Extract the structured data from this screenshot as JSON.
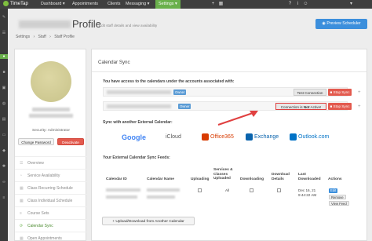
{
  "app": {
    "logo_text": "TimeTap"
  },
  "nav": {
    "items": [
      {
        "label": "Dashboard ▾"
      },
      {
        "label": "Appointments"
      },
      {
        "label": "Clients"
      },
      {
        "label": "Messaging ▾"
      },
      {
        "label": "Settings ▾"
      }
    ]
  },
  "header": {
    "title": "Profile",
    "subtitle": "Edit staff details and view availability",
    "preview_button": "Preview Scheduler"
  },
  "breadcrumb": [
    "Settings",
    "›",
    "Staff",
    "›",
    "Staff Profile"
  ],
  "profile": {
    "security": "Security: Administrator",
    "change_password": "Change Password",
    "deactivate": "Deactivate",
    "menu": [
      {
        "label": "Overview"
      },
      {
        "label": "Service Availability"
      },
      {
        "label": "Class Recurring Schedule"
      },
      {
        "label": "Class Individual Schedule"
      },
      {
        "label": "Course Sets"
      },
      {
        "label": "Calendar Sync"
      },
      {
        "label": "Open Appointments"
      }
    ]
  },
  "calendar_sync": {
    "heading": "Calendar Sync",
    "access_label": "You have access to the calendars under the accounts associated with:",
    "accounts": [
      {
        "owner_badge": "Owner",
        "test_button": "Test Connection",
        "stop_button": "Stop Sync"
      },
      {
        "owner_badge": "Owner",
        "status_prefix": "Connection is ",
        "status_bold": "Not",
        "status_suffix": " Active!",
        "stop_button": "Stop Sync"
      }
    ],
    "sync_label": "Sync with another External Calendar:",
    "providers": [
      {
        "name": "Google",
        "color": "#4285f4"
      },
      {
        "name": "iCloud",
        "color": "#9aa4ad"
      },
      {
        "name": "Office365",
        "color": "#d83b01"
      },
      {
        "name": "Exchange",
        "color": "#0a64ad"
      },
      {
        "name": "Outlook.com",
        "color": "#0072c6"
      }
    ],
    "feeds_label": "Your External Calendar Sync Feeds:",
    "table": {
      "headers": {
        "calendar_id": "Calendar ID",
        "calendar_name": "Calendar Name",
        "uploading": "Uploading",
        "services_line1": "Services &",
        "services_line2": "Classes",
        "services_line3": "Uploaded",
        "downloading": "Downloading",
        "download_line1": "Download",
        "download_line2": "Details",
        "last_line1": "Last",
        "last_line2": "Downloaded",
        "actions": "Actions"
      },
      "row": {
        "services": "All",
        "last_downloaded_line1": "Dec 16, 21",
        "last_downloaded_line2": "9:44:22 AM",
        "edit": "Edit",
        "remove": "Remove",
        "view_feed": "View Feed"
      }
    },
    "upload_button": "+ Upload/Download from Another Calendar"
  }
}
